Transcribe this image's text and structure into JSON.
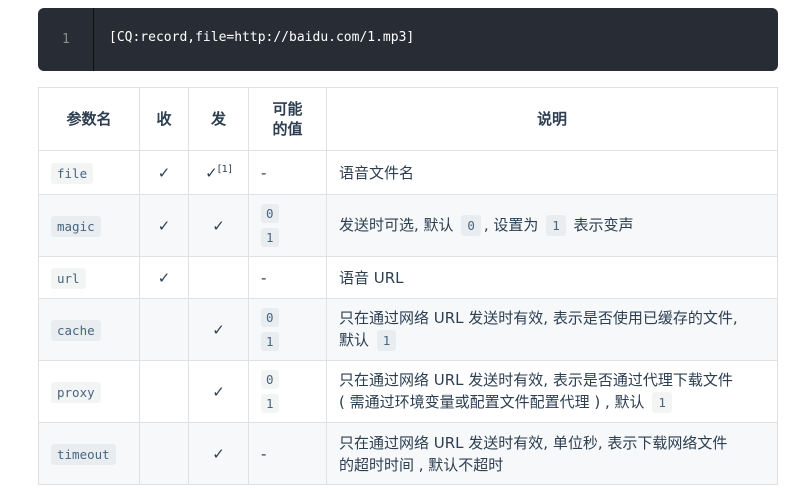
{
  "code_block": {
    "line_number": "1",
    "code": "[CQ:record,file=http://baidu.com/1.mp3]"
  },
  "table": {
    "headers": {
      "name": "参数名",
      "recv": "收",
      "send": "发",
      "values": "可能的值",
      "desc": "说明"
    },
    "rows": [
      {
        "name": "file",
        "recv": "✓",
        "send": "✓",
        "send_footnote": "[1]",
        "value_text": "-",
        "desc": "语音文件名"
      },
      {
        "name": "magic",
        "recv": "✓",
        "send": "✓",
        "values": [
          "0",
          "1"
        ],
        "desc_parts": [
          "发送时可选, 默认",
          "0",
          ", 设置为",
          "1",
          "表示变声"
        ]
      },
      {
        "name": "url",
        "recv": "✓",
        "send": "",
        "value_text": "-",
        "desc": "语音 URL"
      },
      {
        "name": "cache",
        "recv": "",
        "send": "✓",
        "values": [
          "0",
          "1"
        ],
        "desc_line1": "只在通过网络 URL 发送时有效, 表示是否使用已缓存的文件,",
        "desc_line2_text": "默认",
        "desc_line2_code": "1"
      },
      {
        "name": "proxy",
        "recv": "",
        "send": "✓",
        "values": [
          "0",
          "1"
        ],
        "desc_line1": "只在通过网络 URL 发送时有效, 表示是否通过代理下载文件",
        "desc_line2_text": "( 需通过环境变量或配置文件配置代理 ) , 默认",
        "desc_line2_code": "1"
      },
      {
        "name": "timeout",
        "recv": "",
        "send": "✓",
        "value_text": "-",
        "desc_line1": "只在通过网络 URL 发送时有效, 单位秒, 表示下载网络文件",
        "desc_line2_text": "的超时时间 , 默认不超时"
      }
    ]
  },
  "colors": {
    "code_bg": "#282c34",
    "border": "#dfe2e5",
    "row_shade": "#f6f8fa",
    "text": "#2c3e50",
    "inline_code": "#476582"
  }
}
